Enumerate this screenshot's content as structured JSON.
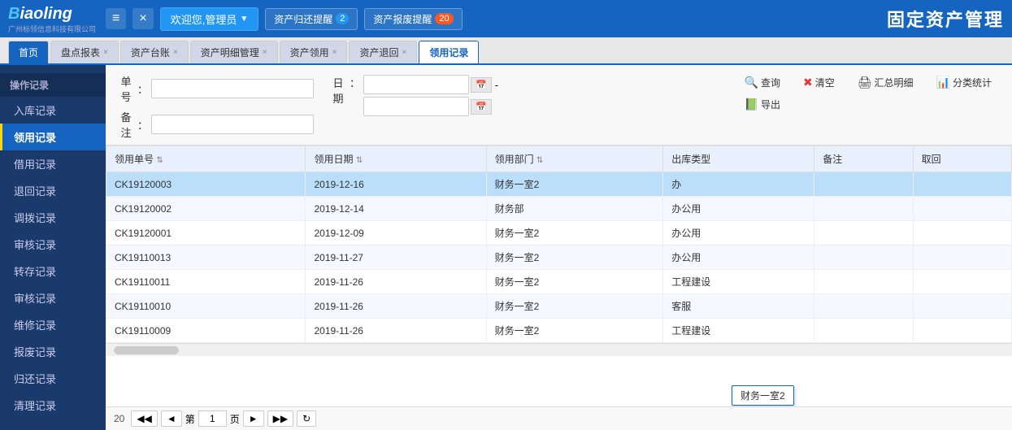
{
  "header": {
    "logo_main": "Biaoling",
    "logo_sub": "广州标领信息科技有限公司",
    "nav_collapse": "≡",
    "nav_close": "×",
    "welcome": "欢迎您,管理员",
    "alert1_text": "资产归还提醒",
    "alert1_badge": "2",
    "alert2_text": "资产报废提醒",
    "alert2_badge": "20",
    "app_title": "固定资产管理"
  },
  "tabs": [
    {
      "label": "首页",
      "closable": false,
      "active": false
    },
    {
      "label": "盘点报表",
      "closable": true,
      "active": false
    },
    {
      "label": "资产台账",
      "closable": true,
      "active": false
    },
    {
      "label": "资产明细管理",
      "closable": true,
      "active": false
    },
    {
      "label": "资产领用",
      "closable": true,
      "active": false
    },
    {
      "label": "资产退回",
      "closable": true,
      "active": false
    },
    {
      "label": "领用记录",
      "closable": false,
      "active": true
    }
  ],
  "sidebar": {
    "group1": "操作记录",
    "items": [
      {
        "label": "入库记录",
        "active": false
      },
      {
        "label": "领用记录",
        "active": true
      },
      {
        "label": "借用记录",
        "active": false
      },
      {
        "label": "退回记录",
        "active": false
      },
      {
        "label": "调拨记录",
        "active": false
      },
      {
        "label": "审核记录",
        "active": false
      },
      {
        "label": "转存记录",
        "active": false
      },
      {
        "label": "审核记录",
        "active": false
      },
      {
        "label": "维修记录",
        "active": false
      },
      {
        "label": "报废记录",
        "active": false
      },
      {
        "label": "归还记录",
        "active": false
      },
      {
        "label": "清理记录",
        "active": false
      }
    ]
  },
  "form": {
    "label_order_no": "单号",
    "label_date": "日期",
    "label_note": "备注",
    "order_no_placeholder": "",
    "date_from_placeholder": "",
    "date_to_placeholder": "",
    "note_placeholder": ""
  },
  "toolbar": {
    "search": "查询",
    "clear": "清空",
    "summary": "汇总明细",
    "classify": "分类统计",
    "export": "导出"
  },
  "table": {
    "columns": [
      {
        "label": "领用单号",
        "sortable": true
      },
      {
        "label": "领用日期",
        "sortable": true
      },
      {
        "label": "领用部门",
        "sortable": true
      },
      {
        "label": "出库类型",
        "sortable": false
      },
      {
        "label": "备注",
        "sortable": false
      },
      {
        "label": "取回",
        "sortable": false
      }
    ],
    "rows": [
      {
        "id": "CK19120003",
        "date": "2019-12-16",
        "dept": "财务一室2",
        "type": "办",
        "note": "",
        "highlighted": true
      },
      {
        "id": "CK19120002",
        "date": "2019-12-14",
        "dept": "财务部",
        "type": "办公用",
        "note": ""
      },
      {
        "id": "CK19120001",
        "date": "2019-12-09",
        "dept": "财务一室2",
        "type": "办公用",
        "note": ""
      },
      {
        "id": "CK19110013",
        "date": "2019-11-27",
        "dept": "财务一室2",
        "type": "办公用",
        "note": ""
      },
      {
        "id": "CK19110011",
        "date": "2019-11-26",
        "dept": "财务一室2",
        "type": "工程建设",
        "note": ""
      },
      {
        "id": "CK19110010",
        "date": "2019-11-26",
        "dept": "财务一室2",
        "type": "客服",
        "note": ""
      },
      {
        "id": "CK19110009",
        "date": "2019-11-26",
        "dept": "财务一室2",
        "type": "工程建设",
        "note": ""
      }
    ],
    "tooltip": "财务一室2"
  },
  "pagination": {
    "total_label": "20",
    "prev_label": "◄",
    "next_label": "►",
    "first_label": "◀◀",
    "last_label": "▶▶",
    "page_label": "第",
    "page_of": "页",
    "current_page": "1",
    "refresh_label": "↻"
  }
}
